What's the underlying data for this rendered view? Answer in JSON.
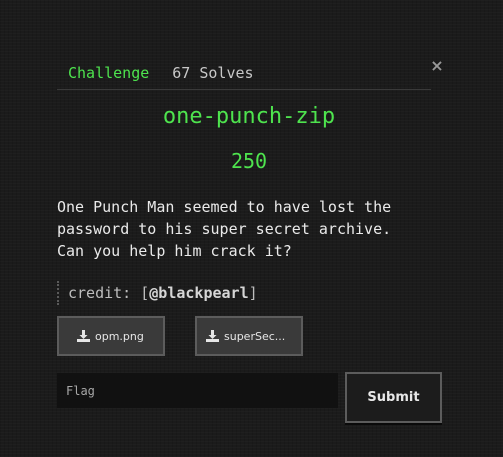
{
  "modal": {
    "close_label": "×",
    "tabs": [
      {
        "label": "Challenge",
        "active": true
      },
      {
        "label": "67 Solves",
        "active": false
      }
    ],
    "title": "one-punch-zip",
    "value": "250",
    "description": "One Punch Man seemed to have lost the\npassword to his super secret archive.\nCan you help him crack it?",
    "credit": {
      "prefix": "credit: [",
      "author": "@blackpearl",
      "suffix": "]"
    },
    "files": [
      {
        "label": "opm.png",
        "icon": "download-icon"
      },
      {
        "label": "superSec...",
        "icon": "download-icon"
      }
    ],
    "flag_input": {
      "value": "",
      "placeholder": "Flag"
    },
    "submit_label": "Submit"
  },
  "colors": {
    "accent": "#4ee44e",
    "background": "#1b1b1b",
    "button_bg": "#3a3a3a",
    "button_border": "#5c5c5c",
    "input_bg": "#111111"
  }
}
